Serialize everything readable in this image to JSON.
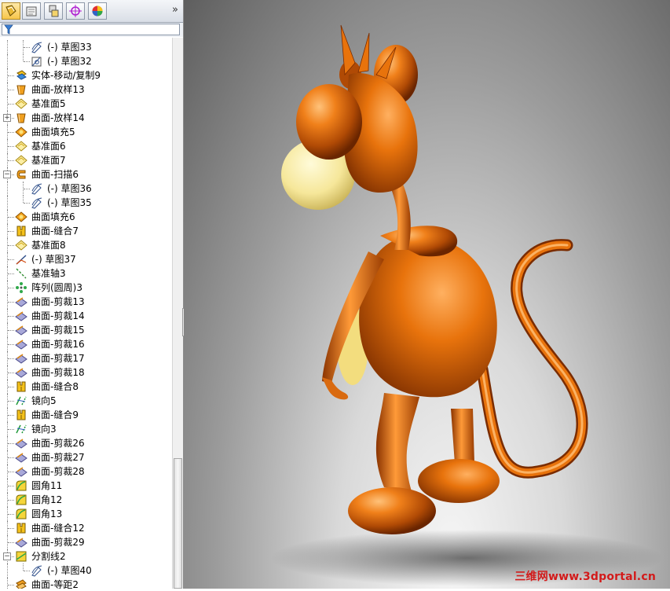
{
  "panel": {
    "tabs": [
      "FeatureManager",
      "PropertyManager",
      "ConfigurationManager",
      "DimXpertManager",
      "DisplayManager"
    ],
    "more_glyph": "»",
    "filter_icon": "filter-icon"
  },
  "tree": [
    {
      "label": "(-) 草图33",
      "icon": "sketch",
      "level": 2
    },
    {
      "label": "(-) 草图32",
      "icon": "sketch-point",
      "level": 2
    },
    {
      "label": "实体-移动/复制9",
      "icon": "move-copy",
      "level": 1
    },
    {
      "label": "曲面-放样13",
      "icon": "loft-surface",
      "level": 1
    },
    {
      "label": "基准面5",
      "icon": "plane",
      "level": 1
    },
    {
      "label": "曲面-放样14",
      "icon": "loft-surface",
      "level": 1,
      "expand": "+"
    },
    {
      "label": "曲面填充5",
      "icon": "fill-surface",
      "level": 1
    },
    {
      "label": "基准面6",
      "icon": "plane",
      "level": 1
    },
    {
      "label": "基准面7",
      "icon": "plane",
      "level": 1
    },
    {
      "label": "曲面-扫描6",
      "icon": "sweep-surface",
      "level": 1,
      "expand": "−"
    },
    {
      "label": "(-) 草图36",
      "icon": "sketch",
      "level": 2
    },
    {
      "label": "(-) 草图35",
      "icon": "sketch",
      "level": 2
    },
    {
      "label": "曲面填充6",
      "icon": "fill-surface",
      "level": 1
    },
    {
      "label": "曲面-缝合7",
      "icon": "knit-surface",
      "level": 1
    },
    {
      "label": "基准面8",
      "icon": "plane",
      "level": 1
    },
    {
      "label": "(-) 草图37",
      "icon": "sketch-3d",
      "level": 1
    },
    {
      "label": "基准轴3",
      "icon": "axis",
      "level": 1
    },
    {
      "label": "阵列(圆周)3",
      "icon": "circular-pattern",
      "level": 1
    },
    {
      "label": "曲面-剪裁13",
      "icon": "trim-surface",
      "level": 1
    },
    {
      "label": "曲面-剪裁14",
      "icon": "trim-surface",
      "level": 1
    },
    {
      "label": "曲面-剪裁15",
      "icon": "trim-surface",
      "level": 1
    },
    {
      "label": "曲面-剪裁16",
      "icon": "trim-surface",
      "level": 1
    },
    {
      "label": "曲面-剪裁17",
      "icon": "trim-surface",
      "level": 1
    },
    {
      "label": "曲面-剪裁18",
      "icon": "trim-surface",
      "level": 1
    },
    {
      "label": "曲面-缝合8",
      "icon": "knit-surface",
      "level": 1
    },
    {
      "label": "镜向5",
      "icon": "mirror",
      "level": 1
    },
    {
      "label": "曲面-缝合9",
      "icon": "knit-surface",
      "level": 1
    },
    {
      "label": "镜向3",
      "icon": "mirror",
      "level": 1
    },
    {
      "label": "曲面-剪裁26",
      "icon": "trim-surface",
      "level": 1
    },
    {
      "label": "曲面-剪裁27",
      "icon": "trim-surface",
      "level": 1
    },
    {
      "label": "曲面-剪裁28",
      "icon": "trim-surface",
      "level": 1
    },
    {
      "label": "圆角11",
      "icon": "fillet",
      "level": 1
    },
    {
      "label": "圆角12",
      "icon": "fillet",
      "level": 1
    },
    {
      "label": "圆角13",
      "icon": "fillet",
      "level": 1
    },
    {
      "label": "曲面-缝合12",
      "icon": "knit-surface",
      "level": 1
    },
    {
      "label": "曲面-剪裁29",
      "icon": "trim-surface",
      "level": 1
    },
    {
      "label": "分割线2",
      "icon": "split-line",
      "level": 1,
      "expand": "−"
    },
    {
      "label": "(-) 草图40",
      "icon": "sketch",
      "level": 2
    },
    {
      "label": "曲面-等距2",
      "icon": "offset-surface",
      "level": 1
    }
  ],
  "viewport": {
    "model": "cartoon-mouse-model",
    "colors": {
      "body": "#e8730c",
      "body_light": "#ffb060",
      "body_dark": "#8a3300",
      "face": "#f6e79a",
      "bg_dark": "#5e5e5e"
    },
    "watermark": "三维网www.3dportal.cn"
  }
}
